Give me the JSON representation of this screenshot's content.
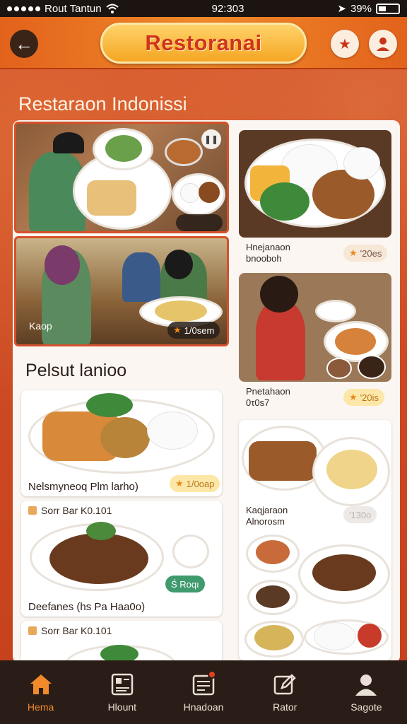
{
  "status_bar": {
    "carrier": "Rout Tantun",
    "time": "92:303",
    "battery": "39%"
  },
  "header": {
    "brand": "Restoranai",
    "back_icon": "arrow-left-icon",
    "favorite_icon": "star-icon",
    "profile_icon": "user-icon"
  },
  "section_title": "Restaraon Indonissi",
  "restaurants": [
    {
      "label": "",
      "menu_icon": "menu-icon"
    },
    {
      "label": "Kaop",
      "badge": "1/0sem"
    }
  ],
  "right_cards": [
    {
      "name_line1": "Hnejanaon",
      "name_line2": "bnooboh",
      "badge": "'20es"
    },
    {
      "name_line1": "Pnetahaon",
      "name_line2": "0τ0s7",
      "badge": "'20is"
    },
    {
      "name_line1": "Kaqjaraon",
      "name_line2": "Alnorosm",
      "badge": "'130o"
    }
  ],
  "sub_section_title": "Pelsut lanioo",
  "dishes": [
    {
      "name": "Nelsmyneoq Plm larho)",
      "badge": "1/0oap"
    },
    {
      "meta": "Sorr Bar K0.101",
      "name": "Deefanes (hs Pa Haa0o)",
      "button": "Ś Roqı"
    },
    {
      "meta": "Sorr Bar K0.101"
    }
  ],
  "bottom_nav": [
    {
      "label": "Hema",
      "icon": "home-icon"
    },
    {
      "label": "Hlount",
      "icon": "menu-book-icon"
    },
    {
      "label": "Hnadoan",
      "icon": "order-list-icon"
    },
    {
      "label": "Rator",
      "icon": "edit-icon"
    },
    {
      "label": "Sagote",
      "icon": "person-icon"
    }
  ],
  "colors": {
    "accent": "#f08a2a",
    "brand_text": "#d0341a",
    "background": "#c8451f",
    "nav_bg": "#2a1d17"
  }
}
